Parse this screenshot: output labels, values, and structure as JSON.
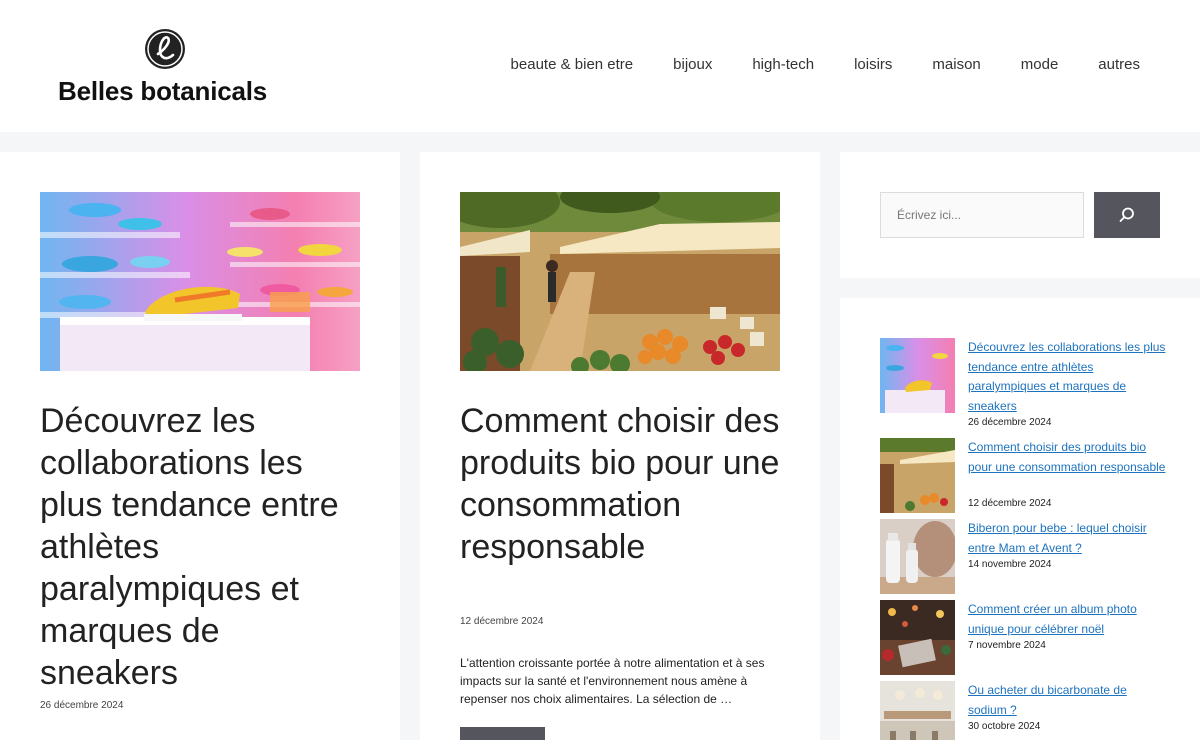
{
  "site": {
    "name": "Belles botanicals",
    "logo_letter": "e"
  },
  "nav": {
    "items": [
      {
        "label": "beaute & bien etre"
      },
      {
        "label": "bijoux"
      },
      {
        "label": "high-tech"
      },
      {
        "label": "loisirs"
      },
      {
        "label": "maison"
      },
      {
        "label": "mode"
      },
      {
        "label": "autres"
      }
    ]
  },
  "articles": [
    {
      "title": "Découvrez les collaborations les plus tendance entre athlètes paralympiques et marques de sneakers",
      "date": "26 décembre 2024"
    },
    {
      "title": "Comment choisir des produits bio pour une consommation responsable",
      "date": "12 décembre 2024",
      "excerpt": "L'attention croissante portée à notre alimentation et à ses impacts sur la santé et l'environnement nous amène à repenser nos choix alimentaires. La sélection de …"
    }
  ],
  "search": {
    "placeholder": "Écrivez ici..."
  },
  "recent_posts": [
    {
      "title": "Découvrez les collaborations les plus tendance entre athlètes paralympiques et marques de sneakers",
      "date": "26 décembre 2024"
    },
    {
      "title": "Comment choisir des produits bio pour une consommation responsable",
      "date": "12 décembre 2024"
    },
    {
      "title": "Biberon pour bebe : lequel choisir entre Mam et Avent ?",
      "date": "14 novembre 2024"
    },
    {
      "title": "Comment créer un album photo unique pour célébrer noël",
      "date": "7 novembre 2024"
    },
    {
      "title": "Ou acheter du bicarbonate de sodium ?",
      "date": "30 octobre 2024"
    }
  ],
  "colors": {
    "link": "#1e73be",
    "button": "#55555e",
    "background": "#f5f6f8"
  }
}
